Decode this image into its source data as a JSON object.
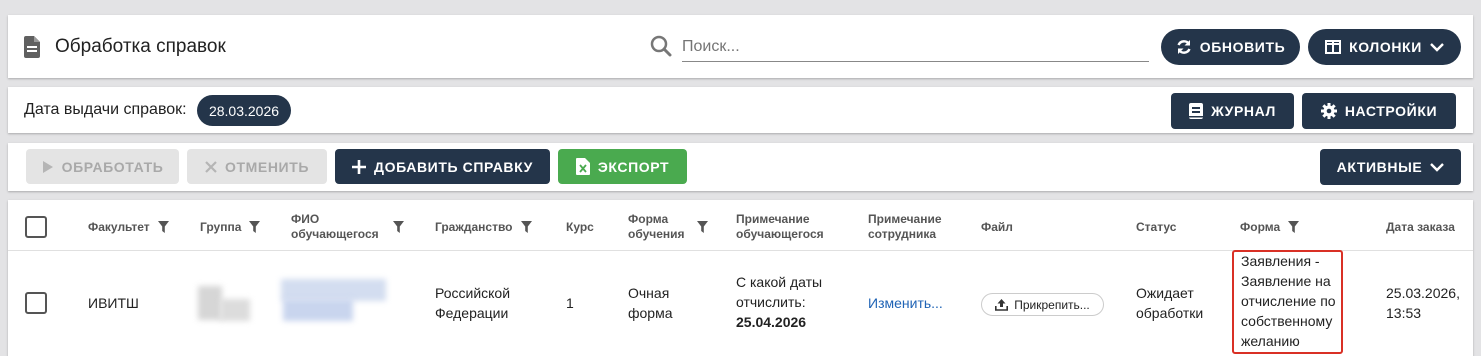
{
  "header": {
    "title": "Обработка справок",
    "search_placeholder": "Поиск...",
    "refresh_label": "ОБНОВИТЬ",
    "columns_label": "КОЛОНКИ"
  },
  "date_bar": {
    "label": "Дата выдачи справок:",
    "date": "28.03.2026",
    "journal_label": "ЖУРНАЛ",
    "settings_label": "НАСТРОЙКИ"
  },
  "toolbar": {
    "process_label": "ОБРАБОТАТЬ",
    "cancel_label": "ОТМЕНИТЬ",
    "add_label": "ДОБАВИТЬ СПРАВКУ",
    "export_label": "ЭКСПОРТ",
    "active_label": "АКТИВНЫЕ"
  },
  "table": {
    "columns": {
      "faculty": "Факультет",
      "group": "Группа",
      "fio_1": "ФИО",
      "fio_2": "обучающегося",
      "citizenship": "Гражданство",
      "course": "Курс",
      "form_1": "Форма",
      "form_2": "обучения",
      "note_student_1": "Примечание",
      "note_student_2": "обучающегося",
      "note_staff_1": "Примечание",
      "note_staff_2": "сотрудника",
      "file": "Файл",
      "status": "Статус",
      "doc_form": "Форма",
      "order_date": "Дата заказа"
    },
    "row": {
      "faculty": "ИВИТШ",
      "citizenship_1": "Российской",
      "citizenship_2": "Федерации",
      "course": "1",
      "form_1": "Очная",
      "form_2": "форма",
      "note_1": "С какой даты",
      "note_2": "отчислить:",
      "note_3": "25.04.2026",
      "edit_link": "Изменить...",
      "attach_label": "Прикрепить...",
      "status_1": "Ожидает",
      "status_2": "обработки",
      "doc_form_lines": [
        "Заявления -",
        "Заявление на",
        "отчисление по",
        "собственному",
        "желанию"
      ],
      "order_date_1": "25.03.2026,",
      "order_date_2": "13:53"
    }
  },
  "colors": {
    "primary": "#24354a",
    "export": "#4aaa4f",
    "link": "#1f63b5",
    "highlight": "#d93025"
  }
}
